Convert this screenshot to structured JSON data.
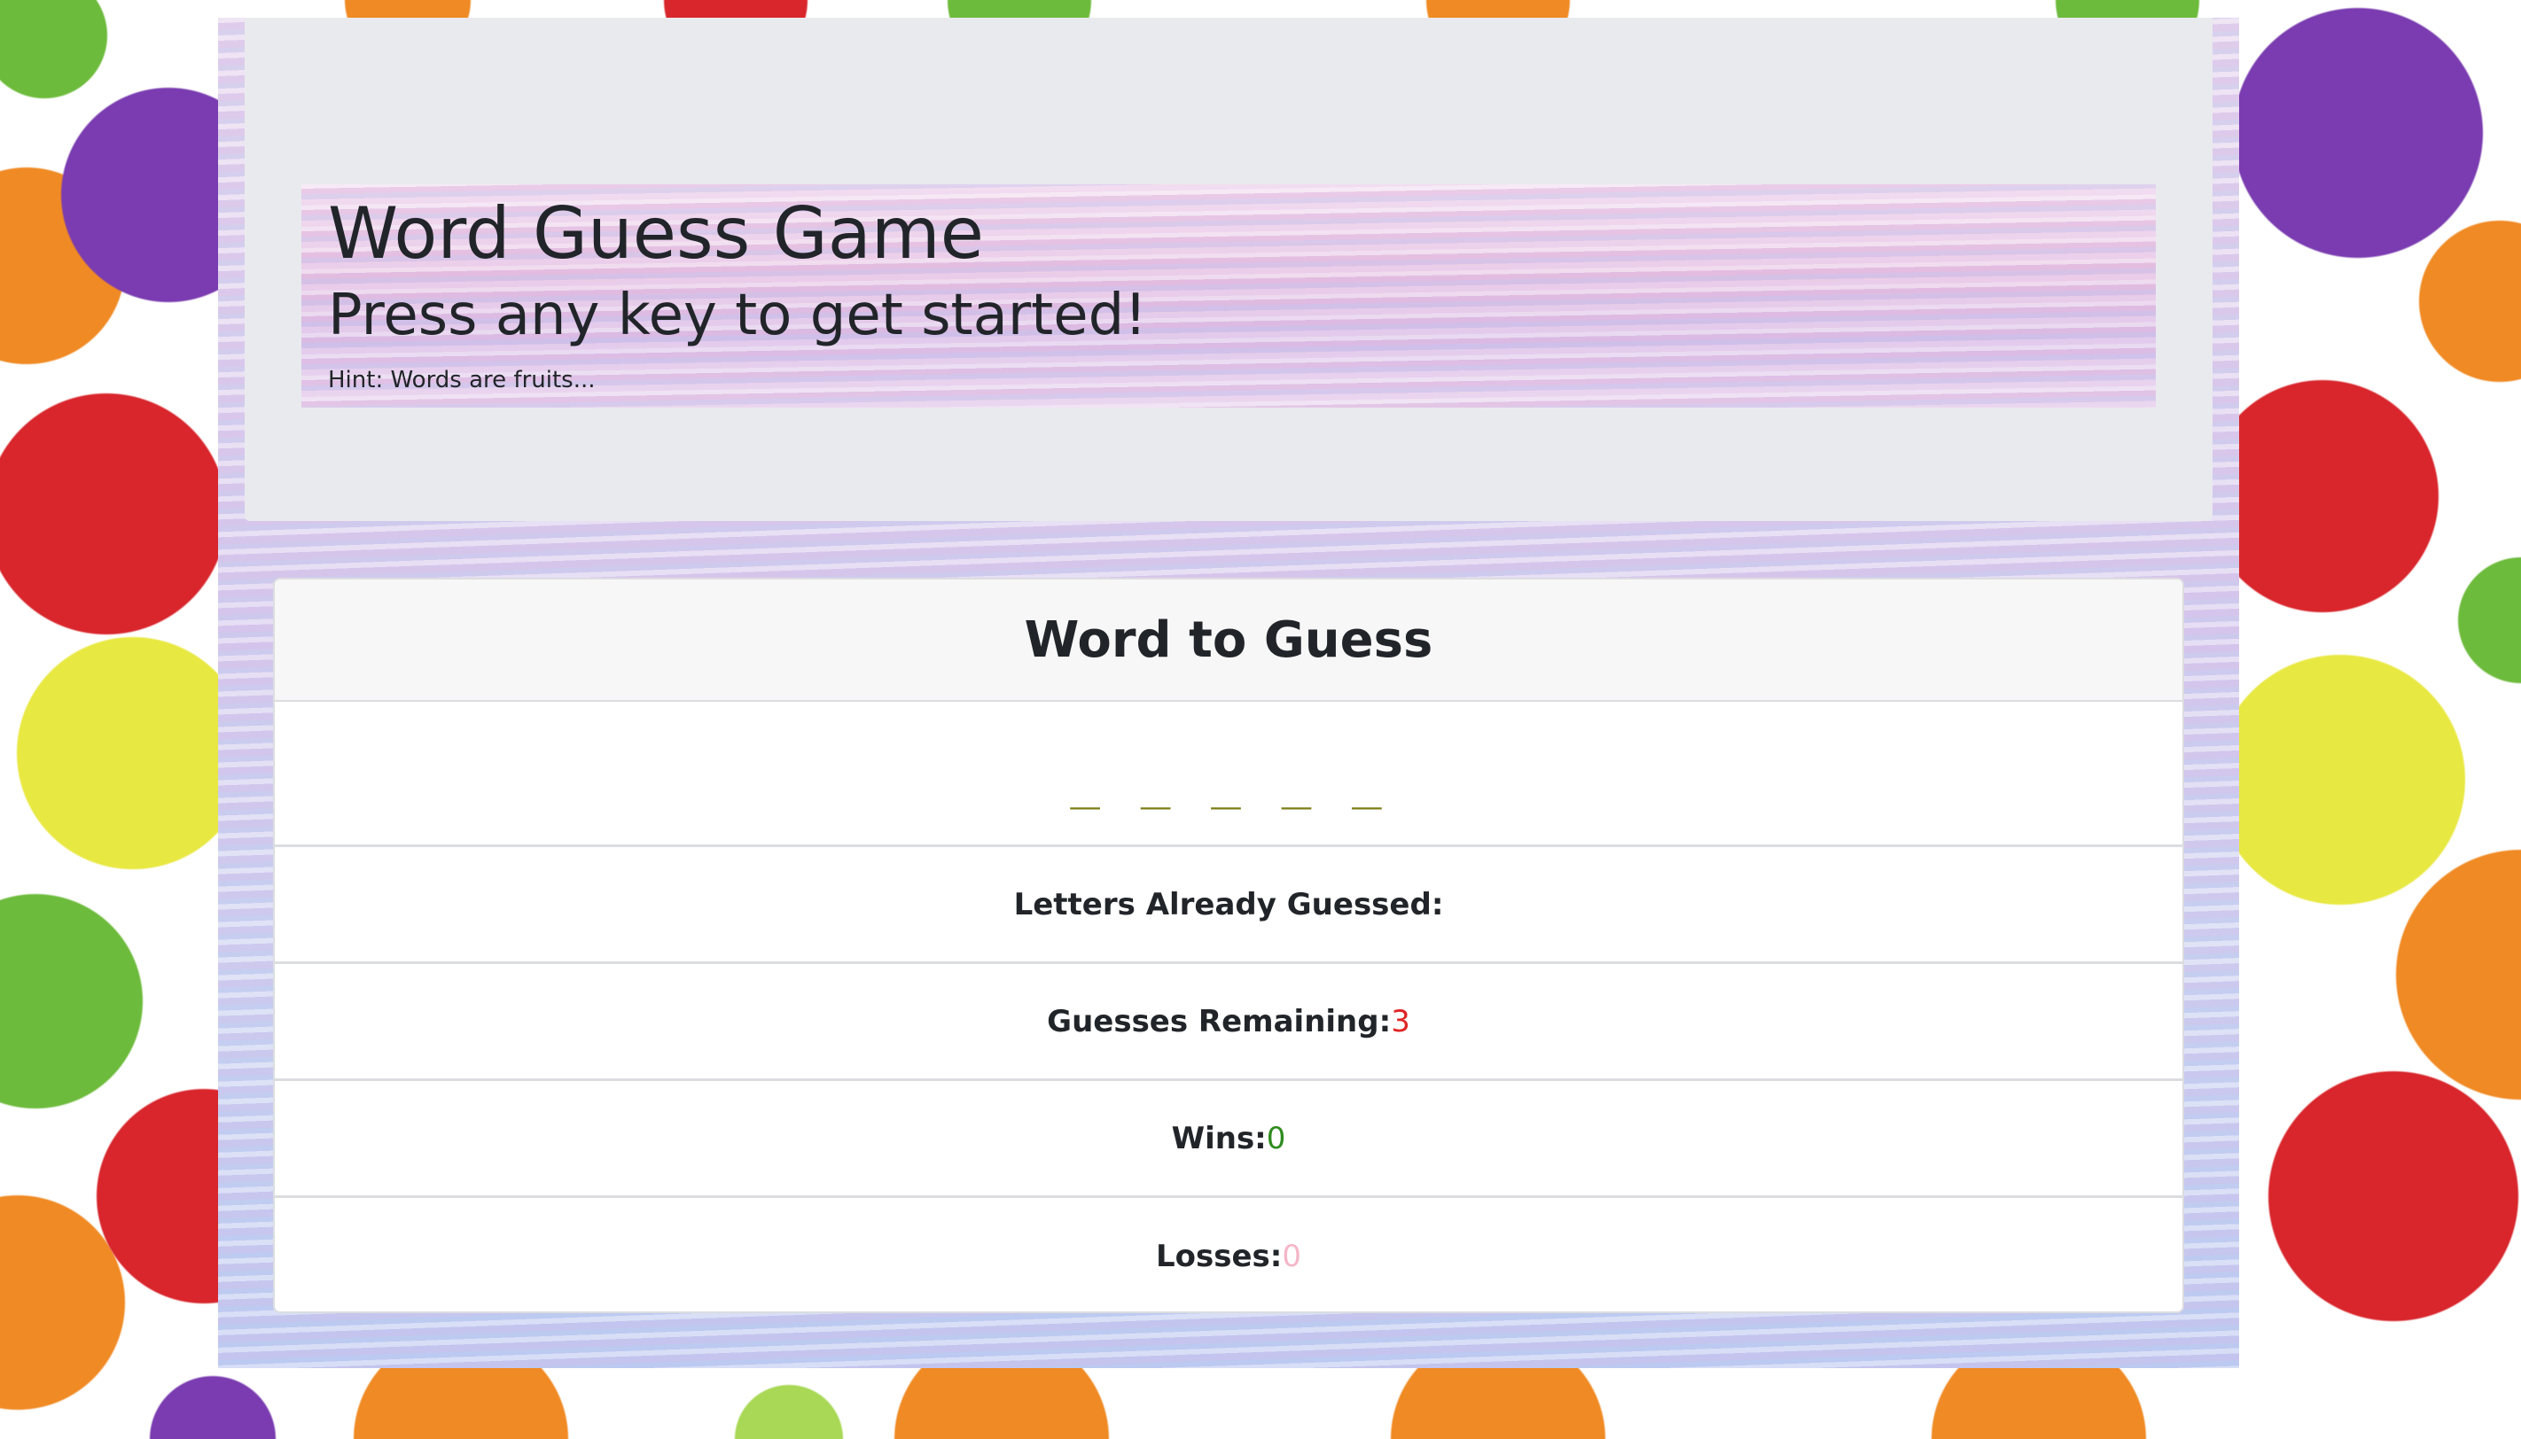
{
  "header": {
    "title": "Word Guess Game",
    "subtitle": "Press any key to get started!",
    "hint": "Hint: Words are fruits..."
  },
  "card": {
    "title": "Word to Guess",
    "word_display": "_ _ _ _ _",
    "letters_guessed": {
      "label": "Letters Already Guessed:",
      "value": ""
    },
    "guesses_remaining": {
      "label": "Guesses Remaining:",
      "value": "3"
    },
    "wins": {
      "label": "Wins:",
      "value": "0"
    },
    "losses": {
      "label": "Losses:",
      "value": "0"
    }
  },
  "colors": {
    "word": "#7d7d17",
    "guesses_remaining": "#e02424",
    "wins": "#2e8b1e",
    "losses": "#f4b6c8"
  }
}
